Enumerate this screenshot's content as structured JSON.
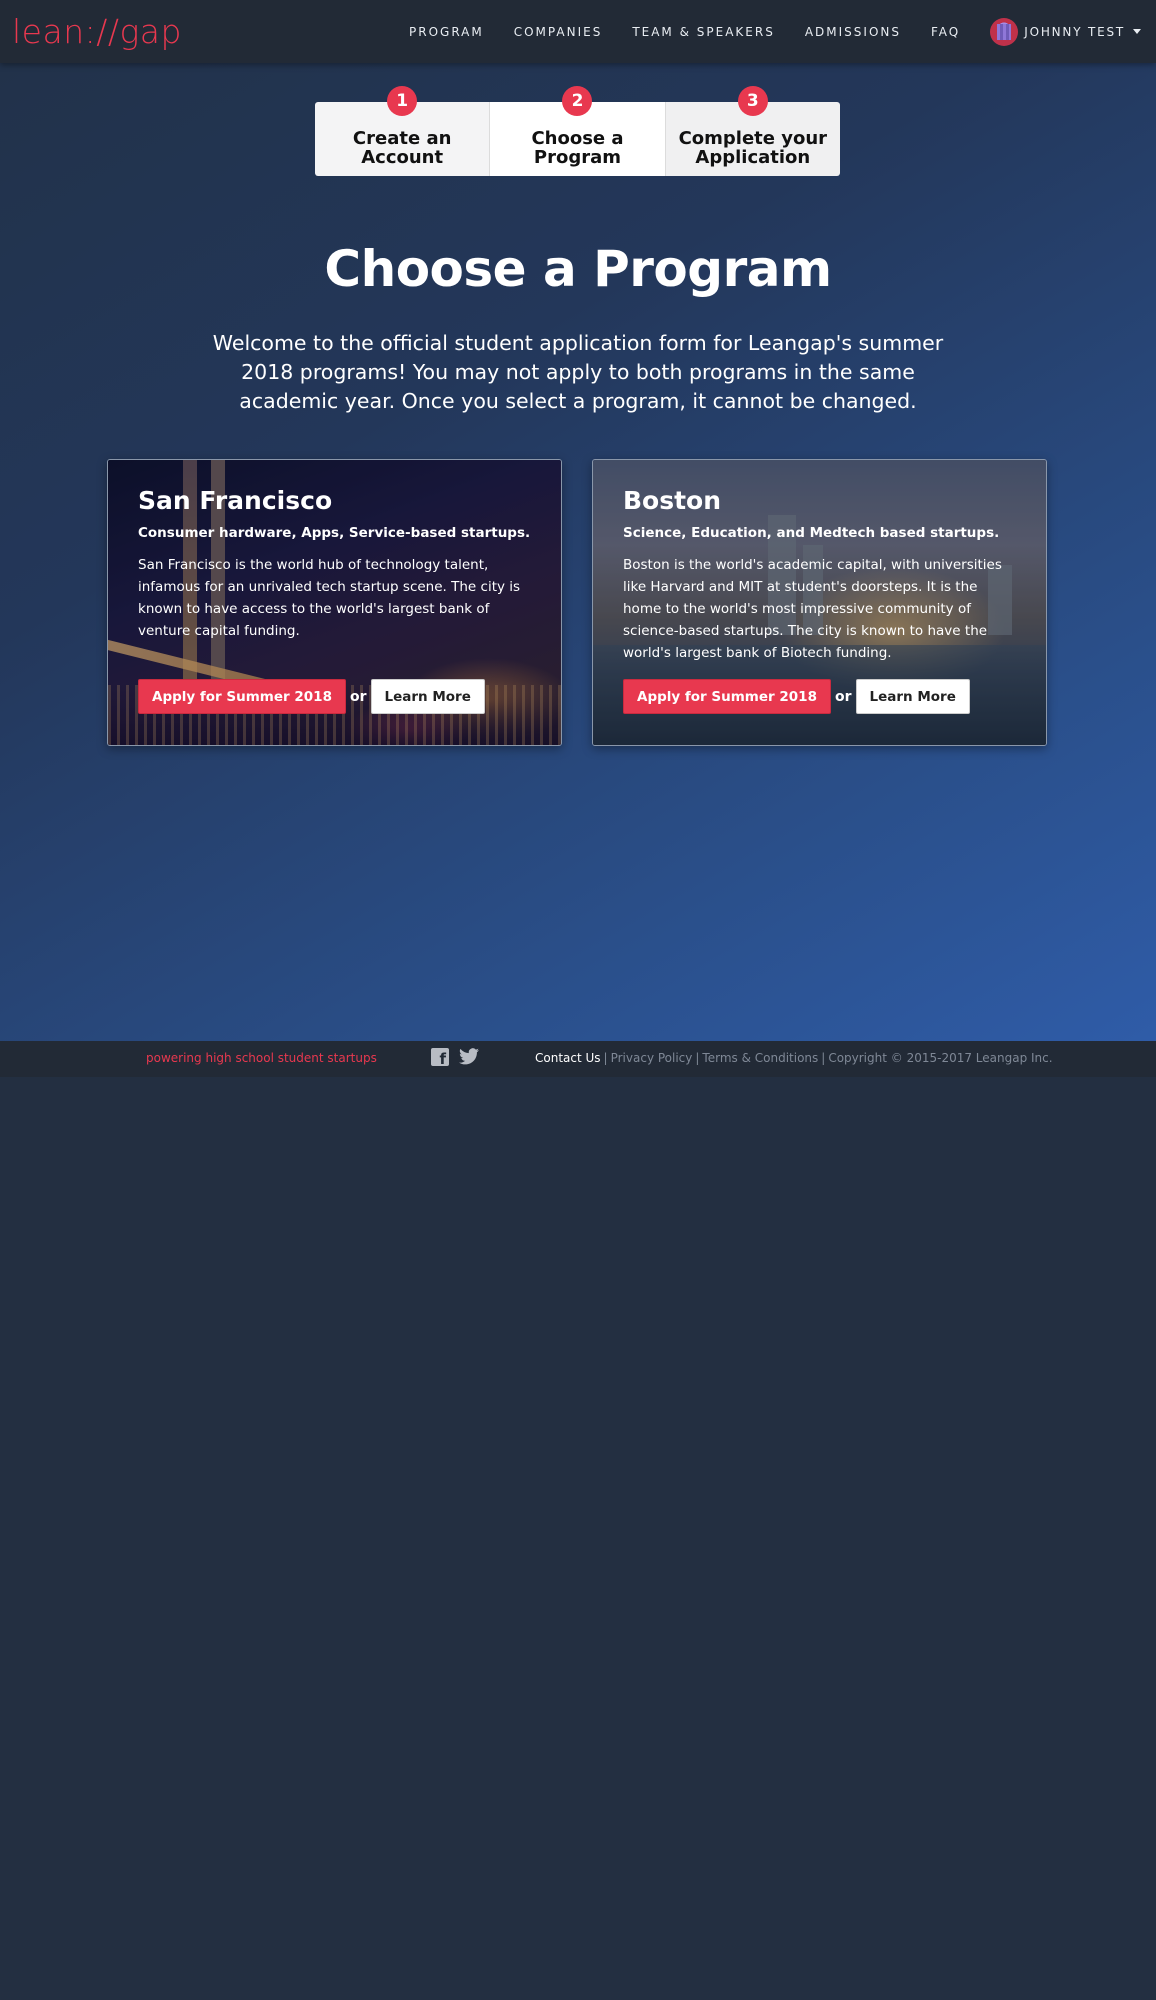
{
  "header": {
    "logo": "lean://gap",
    "nav": [
      "PROGRAM",
      "COMPANIES",
      "TEAM & SPEAKERS",
      "ADMISSIONS",
      "FAQ"
    ],
    "user_name": "JOHNNY TEST"
  },
  "steps": [
    {
      "number": "1",
      "label_line1": "Create an",
      "label_line2": "Account"
    },
    {
      "number": "2",
      "label_line1": "Choose a",
      "label_line2": "Program"
    },
    {
      "number": "3",
      "label_line1": "Complete your",
      "label_line2": "Application"
    }
  ],
  "main": {
    "title": "Choose a Program",
    "intro": "Welcome to the official student application form for Leangap's summer 2018 programs! You may not apply to both programs in the same academic year. Once you select a program, it cannot be changed."
  },
  "programs": [
    {
      "name": "San Francisco",
      "tagline": "Consumer hardware, Apps, Service-based startups.",
      "description": "San Francisco is the world hub of technology talent, infamous for an unrivaled tech startup scene. The city is known to have access to the world's largest bank of venture capital funding.",
      "apply_label": "Apply for Summer 2018",
      "or_label": "or",
      "learn_label": "Learn More"
    },
    {
      "name": "Boston",
      "tagline": "Science, Education, and Medtech based startups.",
      "description": "Boston is the world's academic capital, with universities like Harvard and MIT at student's doorsteps. It is the home to the world's most impressive community of science-based startups. The city is known to have the world's largest bank of Biotech funding.",
      "apply_label": "Apply for Summer 2018",
      "or_label": "or",
      "learn_label": "Learn More"
    }
  ],
  "footer": {
    "tagline": "powering high school student startups",
    "contact": "Contact Us",
    "privacy": "Privacy Policy",
    "terms": "Terms & Conditions",
    "copyright": "Copyright © 2015-2017 Leangap Inc.",
    "separator": "|"
  },
  "colors": {
    "accent": "#e8384f",
    "navbar": "#222a36",
    "background": "#232f41"
  }
}
